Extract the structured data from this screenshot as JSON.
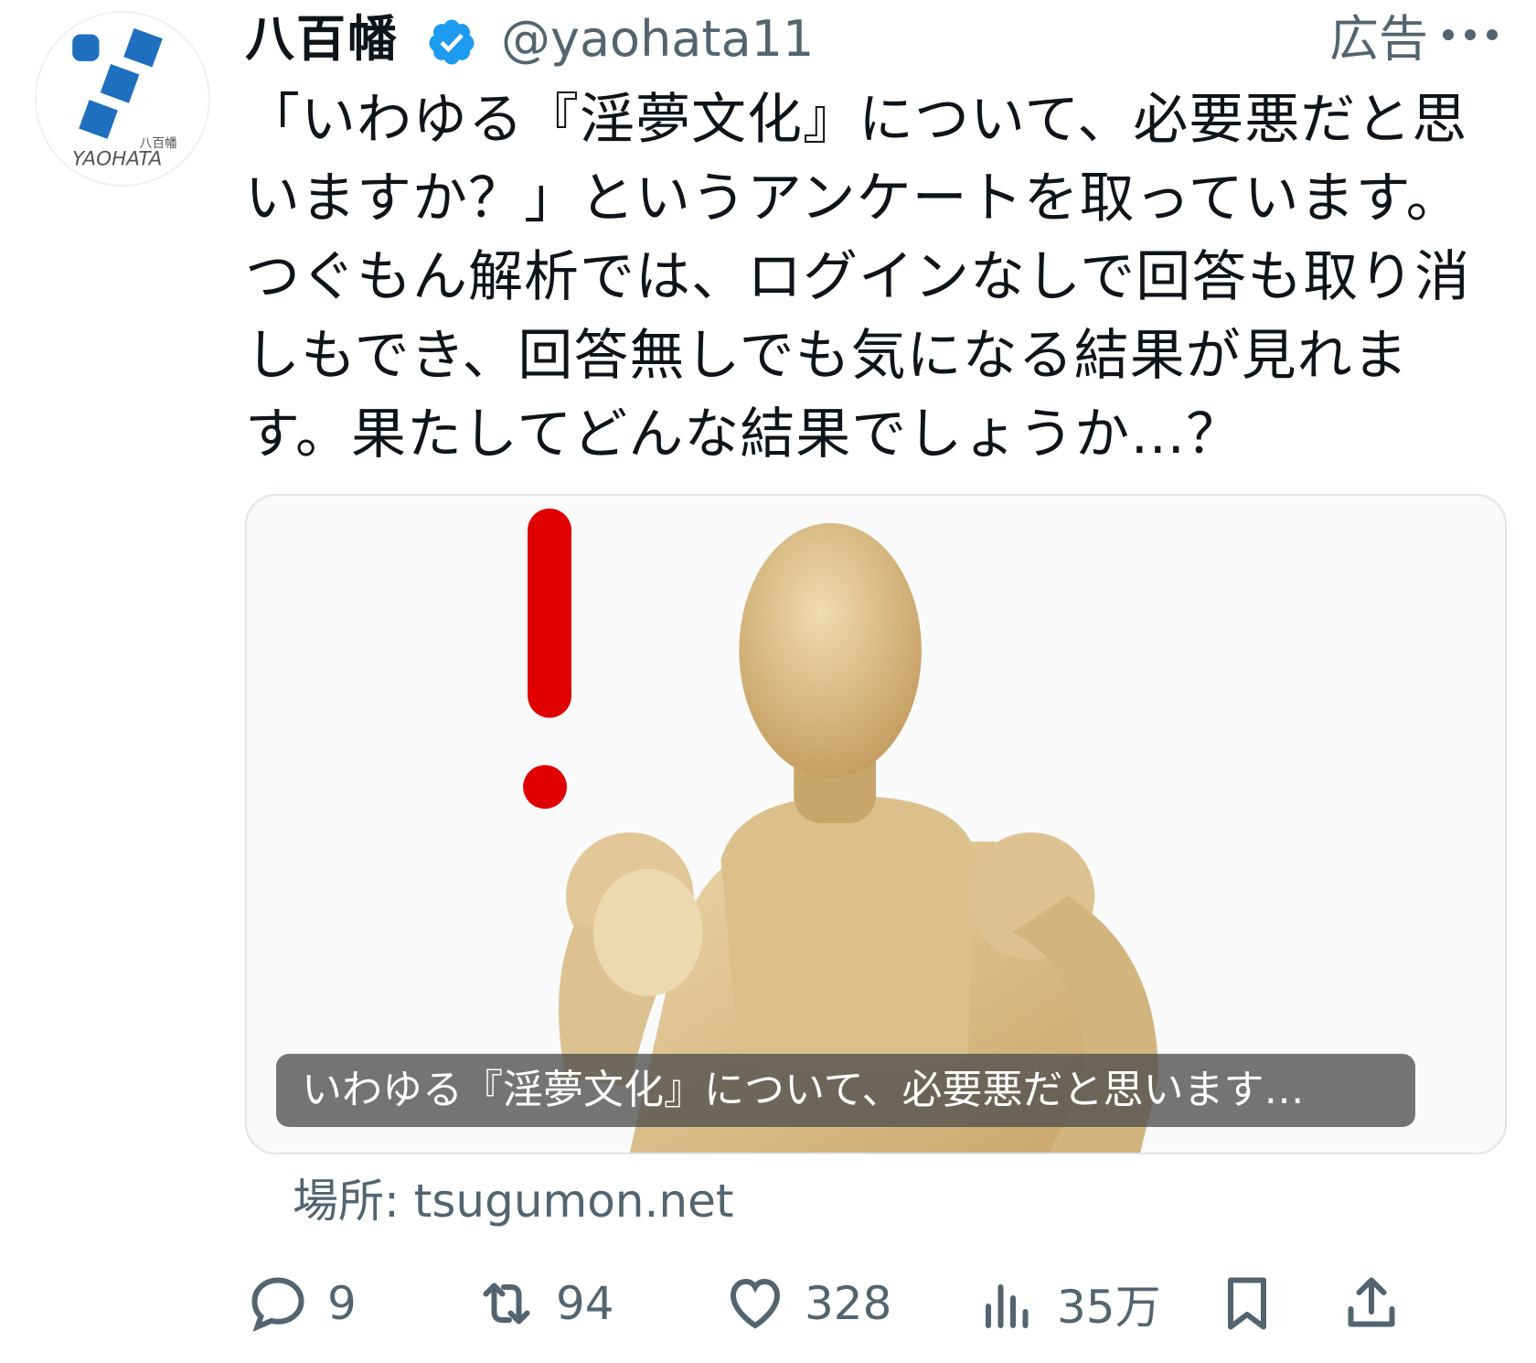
{
  "author": {
    "display_name": "八百幡",
    "handle": "@yaohata11",
    "avatar_kanji": "八百幡",
    "avatar_brand": "YAOHATA",
    "verified": true,
    "brand_color": "#1f6fbf"
  },
  "ad_label": "広告",
  "more_icon": "more-horizontal-icon",
  "tweet_text": "「いわゆる『淫夢文化』について、必要悪だと思いますか？」というアンケートを取っています。つぐもん解析では、ログインなしで回答も取り消しもでき、回答無しでも気になる結果が見れます。果たしてどんな結果でしょうか…？",
  "card": {
    "caption": "いわゆる『淫夢文化』について、必要悪だと思います…",
    "image_subject": "wooden mannequin with red exclamation mark"
  },
  "source": "場所: tsugumon.net",
  "actions": {
    "reply": {
      "icon": "reply-icon",
      "count": "9"
    },
    "retweet": {
      "icon": "retweet-icon",
      "count": "94"
    },
    "like": {
      "icon": "heart-icon",
      "count": "328"
    },
    "views": {
      "icon": "views-chart-icon",
      "count": "35万"
    },
    "bookmark": {
      "icon": "bookmark-icon"
    },
    "share": {
      "icon": "share-icon"
    }
  },
  "colors": {
    "text": "#0f1419",
    "secondary": "#536471",
    "verified": "#1d9bf0",
    "exclamation": "#e00000"
  }
}
